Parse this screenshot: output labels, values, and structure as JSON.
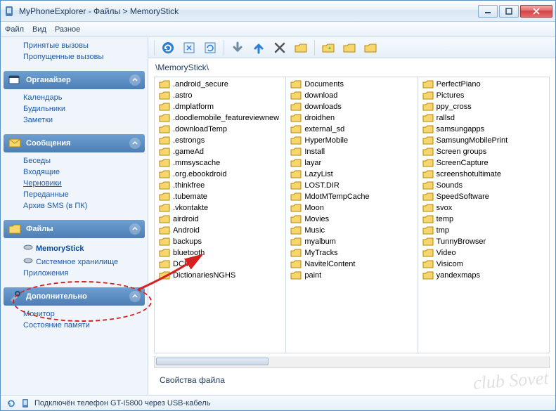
{
  "window": {
    "title": "MyPhoneExplorer - Файлы > MemoryStick"
  },
  "menubar": [
    "Файл",
    "Вид",
    "Разное"
  ],
  "sidebar": {
    "calls": {
      "items": [
        "Принятые вызовы",
        "Пропущенные вызовы"
      ]
    },
    "organizer": {
      "title": "Органайзер",
      "items": [
        "Календарь",
        "Будильники",
        "Заметки"
      ]
    },
    "messages": {
      "title": "Сообщения",
      "items": [
        "Беседы",
        "Входящие",
        "Черновики",
        "Переданные",
        "Архив SMS (в ПК)"
      ]
    },
    "files": {
      "title": "Файлы",
      "items": [
        "MemoryStick",
        "Системное хранилище",
        "Приложения"
      ]
    },
    "extra": {
      "title": "Дополнительно",
      "items": [
        "Монитор",
        "Состояние памяти"
      ]
    }
  },
  "breadcrumb": "\\MemoryStick\\",
  "folders_col1": [
    ".android_secure",
    ".astro",
    ".dmplatform",
    ".doodlemobile_featureviewnew",
    ".downloadTemp",
    ".estrongs",
    ".gameAd",
    ".mmsyscache",
    ".org.ebookdroid",
    ".thinkfree",
    ".tubemate",
    ".vkontakte",
    "airdroid",
    "Android",
    "backups",
    "bluetooth",
    "DCIM",
    "DictionariesNGHS"
  ],
  "folders_col2": [
    "Documents",
    "download",
    "downloads",
    "droidhen",
    "external_sd",
    "HyperMobile",
    "Install",
    "layar",
    "LazyList",
    "LOST.DIR",
    "MdotMTempCache",
    "Moon",
    "Movies",
    "Music",
    "myalbum",
    "MyTracks",
    "NavitelContent",
    "paint"
  ],
  "folders_col3": [
    "PerfectPiano",
    "Pictures",
    "ppy_cross",
    "rallsd",
    "samsungapps",
    "SamsungMobilePrint",
    "Screen groups",
    "ScreenCapture",
    "screenshotultimate",
    "Sounds",
    "SpeedSoftware",
    "svox",
    "temp",
    "tmp",
    "TunnyBrowser",
    "Video",
    "Visicom",
    "yandexmaps"
  ],
  "properties_label": "Свойства файла",
  "statusbar": {
    "text": "Подключён телефон GT-I5800 через USB-кабель"
  },
  "watermark": "club Sovet"
}
